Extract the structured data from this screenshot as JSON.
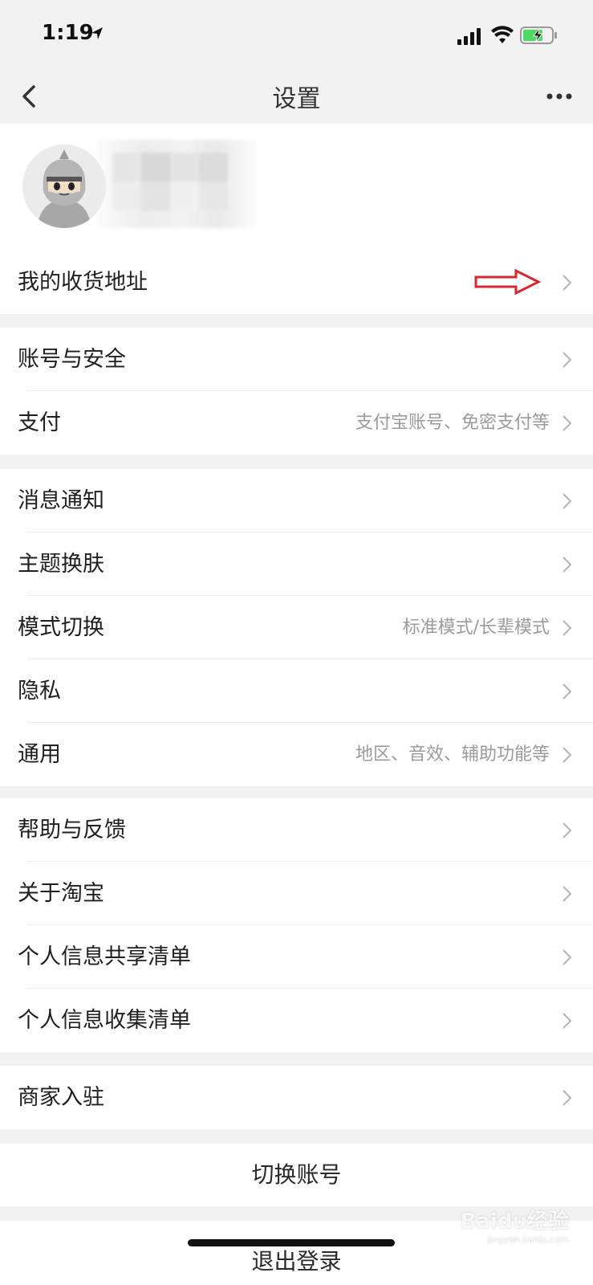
{
  "status_bar": {
    "time": "1:19",
    "icons": [
      "location-arrow-icon",
      "cellular-signal-icon",
      "wifi-icon",
      "battery-charging-icon"
    ]
  },
  "nav": {
    "title": "设置",
    "back_icon": "chevron-left-icon",
    "more_icon": "more-dots-icon"
  },
  "profile": {
    "avatar": "ninja-avatar",
    "name_obscured": true
  },
  "groups": [
    {
      "rows": [
        {
          "label": "我的收货地址",
          "sub": "",
          "annotated": true
        }
      ]
    },
    {
      "rows": [
        {
          "label": "账号与安全",
          "sub": ""
        },
        {
          "label": "支付",
          "sub": "支付宝账号、免密支付等"
        }
      ]
    },
    {
      "rows": [
        {
          "label": "消息通知",
          "sub": ""
        },
        {
          "label": "主题换肤",
          "sub": ""
        },
        {
          "label": "模式切换",
          "sub": "标准模式/长辈模式"
        },
        {
          "label": "隐私",
          "sub": ""
        },
        {
          "label": "通用",
          "sub": "地区、音效、辅助功能等"
        }
      ]
    },
    {
      "rows": [
        {
          "label": "帮助与反馈",
          "sub": ""
        },
        {
          "label": "关于淘宝",
          "sub": ""
        },
        {
          "label": "个人信息共享清单",
          "sub": ""
        },
        {
          "label": "个人信息收集清单",
          "sub": ""
        }
      ]
    },
    {
      "rows": [
        {
          "label": "商家入驻",
          "sub": ""
        }
      ]
    }
  ],
  "actions": {
    "switch_account": "切换账号",
    "logout": "退出登录"
  },
  "watermark": {
    "brand": "Baidu经验",
    "url": "jingyan.baidu.com"
  },
  "colors": {
    "background": "#f2f2f2",
    "row_bg": "#ffffff",
    "secondary_text": "#9b9b9b",
    "annotation_arrow": "#d9262c"
  }
}
